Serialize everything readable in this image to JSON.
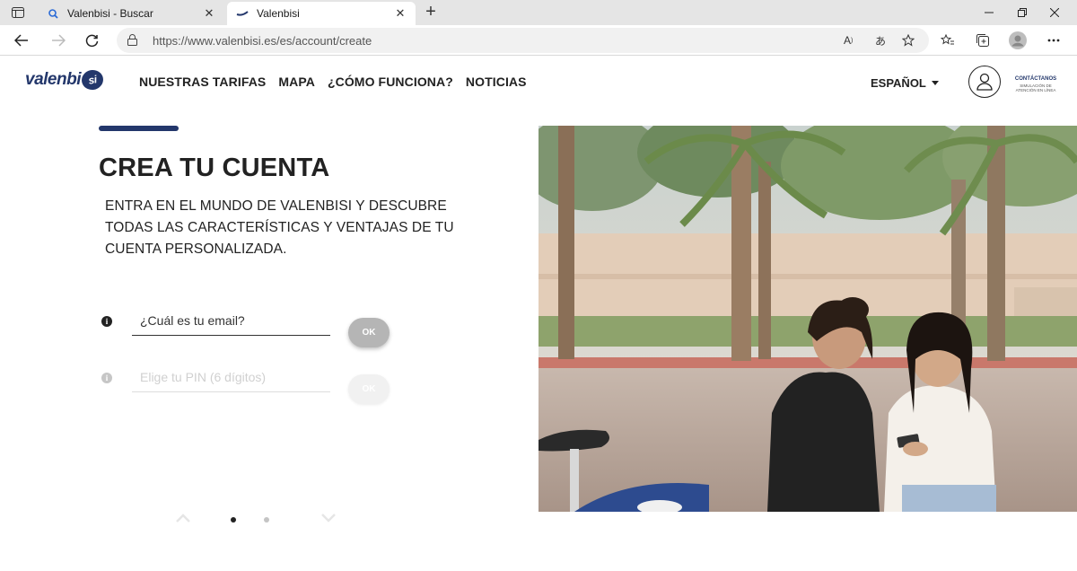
{
  "browser": {
    "tabs": [
      {
        "title": "Valenbisi - Buscar",
        "icon": "search-icon",
        "active": false
      },
      {
        "title": "Valenbisi",
        "icon": "valenbisi-favicon",
        "active": true
      }
    ],
    "url": "https://www.valenbisi.es/es/account/create"
  },
  "header": {
    "logo_text": "valenbi",
    "logo_badge": "si",
    "menu": [
      "NUESTRAS TARIFAS",
      "MAPA",
      "¿CÓMO FUNCIONA?",
      "NOTICIAS"
    ],
    "language": "ESPAÑOL",
    "contact_title": "CONTÁCTANOS",
    "contact_sub": "SIMULACIÓN DE ATENCIÓN EN LÍNEA"
  },
  "page": {
    "title": "CREA TU CUENTA",
    "intro": "ENTRA EN EL MUNDO DE VALENBISI Y DESCUBRE TODAS LAS CARACTERÍSTICAS Y VENTAJAS DE TU CUENTA PERSONALIZADA."
  },
  "form": {
    "email_placeholder": "¿Cuál es tu email?",
    "pin_placeholder": "Elige tu PIN (6 dígitos)",
    "ok_label": "OK"
  },
  "pager": {
    "total": 2,
    "current": 1
  },
  "colors": {
    "brand": "#23376b",
    "ok_active": "#b5b5b5",
    "ok_disabled": "#f1f1f1"
  }
}
